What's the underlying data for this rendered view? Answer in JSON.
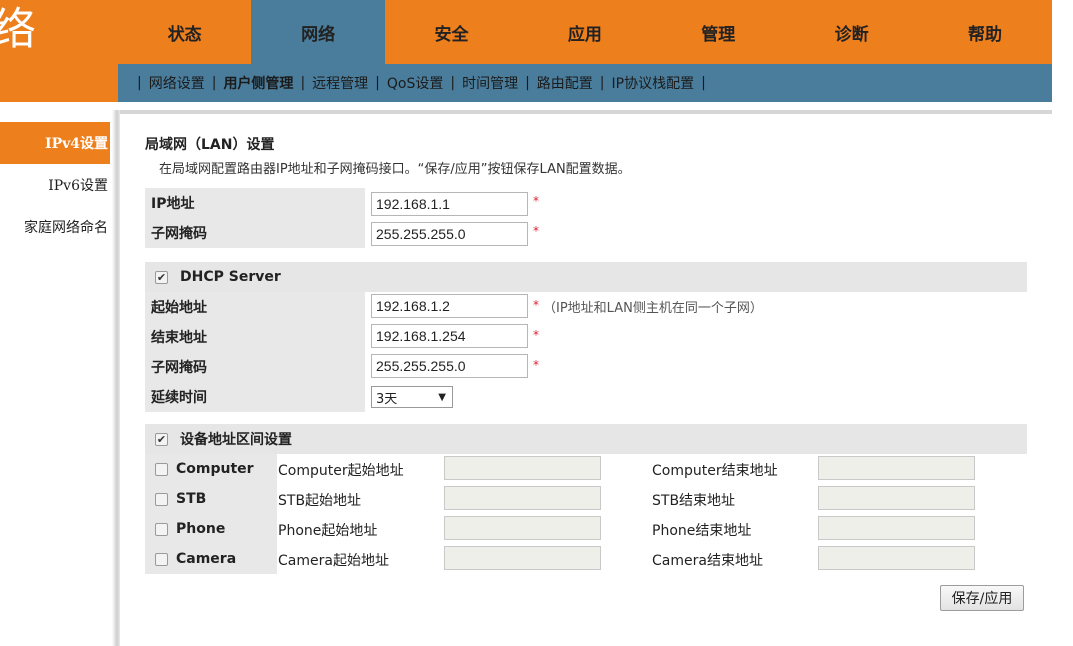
{
  "header": {
    "logo_char": "络",
    "tabs": [
      "状态",
      "网络",
      "安全",
      "应用",
      "管理",
      "诊断",
      "帮助"
    ],
    "active_tab": "网络"
  },
  "subnav": {
    "items": [
      "网络设置",
      "用户侧管理",
      "远程管理",
      "QoS设置",
      "时间管理",
      "路由配置",
      "IP协议栈配置"
    ],
    "active": "用户侧管理"
  },
  "sidebar": {
    "items": [
      "IPv4设置",
      "IPv6设置",
      "家庭网络命名"
    ],
    "active": "IPv4设置"
  },
  "lan": {
    "title": "局域网（LAN）设置",
    "desc": "在局域网配置路由器IP地址和子网掩码接口。“保存/应用”按钮保存LAN配置数据。",
    "ip_label": "IP地址",
    "ip_value": "192.168.1.1",
    "mask_label": "子网掩码",
    "mask_value": "255.255.255.0",
    "required_mark": "*"
  },
  "dhcp": {
    "label": "DHCP Server",
    "checked": true,
    "start_label": "起始地址",
    "start_value": "192.168.1.2",
    "start_hint": "（IP地址和LAN侧主机在同一个子网）",
    "end_label": "结束地址",
    "end_value": "192.168.1.254",
    "mask_label": "子网掩码",
    "mask_value": "255.255.255.0",
    "lease_label": "延续时间",
    "lease_value": "3天"
  },
  "devices": {
    "label": "设备地址区间设置",
    "checked": true,
    "rows": [
      {
        "name": "Computer",
        "start": "Computer起始地址",
        "end": "Computer结束地址"
      },
      {
        "name": "STB",
        "start": "STB起始地址",
        "end": "STB结束地址"
      },
      {
        "name": "Phone",
        "start": "Phone起始地址",
        "end": "Phone结束地址"
      },
      {
        "name": "Camera",
        "start": "Camera起始地址",
        "end": "Camera结束地址"
      }
    ]
  },
  "save_label": "保存/应用",
  "colors": {
    "orange": "#ee7f1d",
    "blue": "#4a7d9c"
  },
  "icons": {
    "checkbox_checked": "check-icon",
    "select_arrow": "triangle-down-icon"
  }
}
